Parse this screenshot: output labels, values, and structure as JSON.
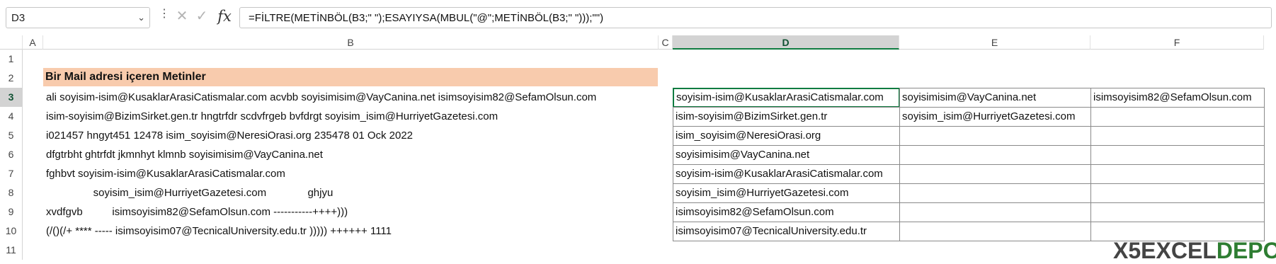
{
  "name_box": {
    "value": "D3"
  },
  "formula": {
    "fx_label": "fx",
    "text": "=FİLTRE(METİNBÖL(B3;\" \");ESAYIYSA(MBUL(\"@\";METİNBÖL(B3;\" \")));\"\")"
  },
  "columns": [
    "A",
    "B",
    "C",
    "D",
    "E",
    "F"
  ],
  "rows": [
    "1",
    "2",
    "3",
    "4",
    "5",
    "6",
    "7",
    "8",
    "9",
    "10",
    "11"
  ],
  "title": "Bir Mail adresi içeren Metinler",
  "b_texts": [
    "ali soyisim-isim@KusaklarArasiCatismalar.com acvbb soyisimisim@VayCanina.net isimsoyisim82@SefamOlsun.com",
    "isim-soyisim@BizimSirket.gen.tr hngtrfdr scdvfrgeb bvfdrgt soyisim_isim@HurriyetGazetesi.com",
    "i021457 hngyt451 12478 isim_soyisim@NeresiOrasi.org 235478 01 Ock 2022",
    "dfgtrbht ghtrfdt jkmnhyt klmnb soyisimisim@VayCanina.net",
    "fghbvt soyisim-isim@KusaklarArasiCatismalar.com",
    "                soyisim_isim@HurriyetGazetesi.com              ghjyu",
    "xvdfgvb          isimsoyisim82@SefamOlsun.com -----------++++)))",
    "(/()(/+ **** ----- isimsoyisim07@TecnicalUniversity.edu.tr ))))) ++++++ 1111"
  ],
  "results": [
    [
      "soyisim-isim@KusaklarArasiCatismalar.com",
      "soyisimisim@VayCanina.net",
      "isimsoyisim82@SefamOlsun.com"
    ],
    [
      "isim-soyisim@BizimSirket.gen.tr",
      "soyisim_isim@HurriyetGazetesi.com",
      ""
    ],
    [
      "isim_soyisim@NeresiOrasi.org",
      "",
      ""
    ],
    [
      "soyisimisim@VayCanina.net",
      "",
      ""
    ],
    [
      "soyisim-isim@KusaklarArasiCatismalar.com",
      "",
      ""
    ],
    [
      "soyisim_isim@HurriyetGazetesi.com",
      "",
      ""
    ],
    [
      "isimsoyisim82@SefamOlsun.com",
      "",
      ""
    ],
    [
      "isimsoyisim07@TecnicalUniversity.edu.tr",
      "",
      ""
    ]
  ],
  "logo": {
    "part1": "X5EXCEL",
    "part2": "DEPO"
  }
}
